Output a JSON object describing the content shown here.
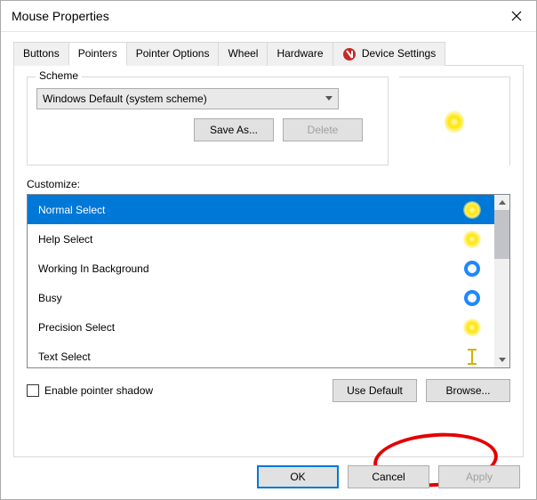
{
  "window": {
    "title": "Mouse Properties"
  },
  "tabs": {
    "items": [
      {
        "label": "Buttons"
      },
      {
        "label": "Pointers"
      },
      {
        "label": "Pointer Options"
      },
      {
        "label": "Wheel"
      },
      {
        "label": "Hardware"
      },
      {
        "label": "Device Settings",
        "icon": "device-settings-icon"
      }
    ],
    "active_index": 1
  },
  "scheme": {
    "legend": "Scheme",
    "selected": "Windows Default (system scheme)",
    "save_as_label": "Save As...",
    "delete_label": "Delete"
  },
  "customize": {
    "label": "Customize:",
    "items": [
      {
        "label": "Normal Select",
        "icon": "cursor-glow-yellow",
        "selected": true
      },
      {
        "label": "Help Select",
        "icon": "cursor-glow-yellow"
      },
      {
        "label": "Working In Background",
        "icon": "cursor-ring-blue"
      },
      {
        "label": "Busy",
        "icon": "cursor-ring-blue"
      },
      {
        "label": "Precision Select",
        "icon": "cursor-glow-yellow"
      },
      {
        "label": "Text Select",
        "icon": "cursor-ibeam-yellow"
      }
    ]
  },
  "preview": {
    "icon": "cursor-glow-yellow"
  },
  "options": {
    "enable_shadow_label": "Enable pointer shadow",
    "enable_shadow_checked": false,
    "use_default_label": "Use Default",
    "browse_label": "Browse..."
  },
  "dialog_buttons": {
    "ok": "OK",
    "cancel": "Cancel",
    "apply": "Apply"
  },
  "annotation": {
    "type": "red-circle",
    "target": "browse-button"
  }
}
